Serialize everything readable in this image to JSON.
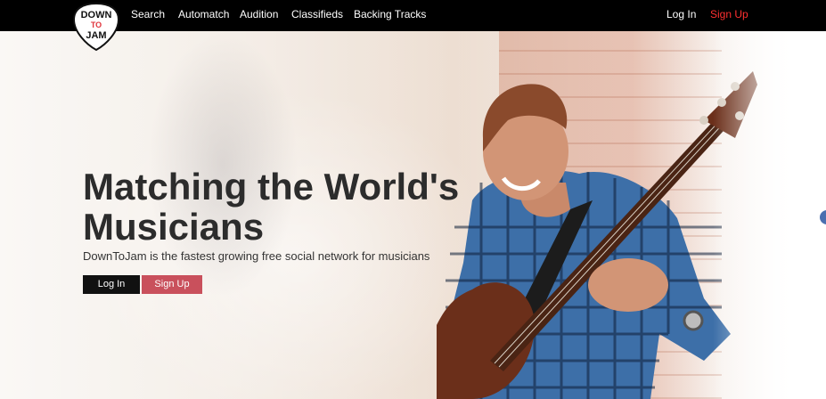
{
  "logo": {
    "line1": "DOWN",
    "line2": "TO",
    "line3": "JAM"
  },
  "nav": {
    "search": "Search",
    "automatch": "Automatch",
    "audition": "Audition",
    "classifieds": "Classifieds",
    "backing_tracks": "Backing Tracks",
    "login": "Log In",
    "signup": "Sign Up"
  },
  "hero": {
    "title_line1": "Matching the World's",
    "title_line2": "Musicians",
    "subtitle": "DownToJam is the fastest growing free social network for musicians",
    "login_button": "Log In",
    "signup_button": "Sign Up"
  },
  "colors": {
    "nav_bg": "#000000",
    "signup_accent": "#ff3030",
    "signup_button_bg": "#c9505c",
    "login_button_bg": "#111111"
  }
}
